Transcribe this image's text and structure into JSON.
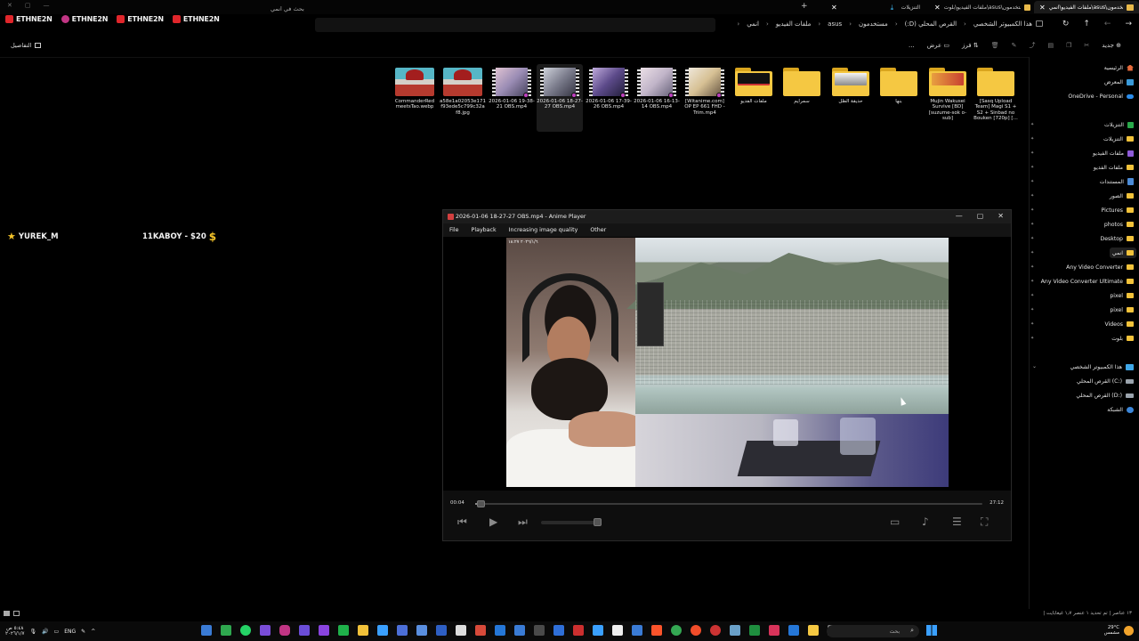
{
  "tabs": [
    {
      "label": "التنزيلات",
      "icon": "download-icon"
    },
    {
      "label": "ملفات الفيديو\\بلوت\\asus\\مستخدمون",
      "icon": "folder-icon"
    },
    {
      "label": "ملفات الفيديو\\انمي\\asus\\مستخدمون",
      "icon": "folder-icon",
      "active": true
    }
  ],
  "brands": [
    "ETHNE2N",
    "ETHNE2N",
    "ETHNE2N",
    "ETHNE2N"
  ],
  "search": {
    "placeholder": "بحث في انمي"
  },
  "breadcrumb": [
    "هذا الكمبيوتر الشخصي",
    "القرص المحلي (D:)",
    "مستخدمون",
    "asus",
    "ملفات الفيديو",
    "انمي"
  ],
  "toolbar": {
    "details": "التفاصيل",
    "new": "جديد",
    "sort": "فرز",
    "view": "عرض",
    "more": "..."
  },
  "files": [
    {
      "name": "CommanderRed meetsTao.webp",
      "kind": "image"
    },
    {
      "name": "a58e1a02053e171 f93ede5c799c32a f8.jpg",
      "kind": "image"
    },
    {
      "name": "2026-01-06 19-38-21 OBS.mp4",
      "kind": "video"
    },
    {
      "name": "2026-01-06 18-27-27 OBS.mp4",
      "kind": "video",
      "selected": true
    },
    {
      "name": "2026-01-06 17-39-26 OBS.mp4",
      "kind": "video"
    },
    {
      "name": "2026-01-06 16-13-14 OBS.mp4",
      "kind": "video"
    },
    {
      "name": "[Witanime.com] OP EP 661 FHD - Trim.mp4",
      "kind": "video"
    },
    {
      "name": "ملفات الفديو",
      "kind": "folder"
    },
    {
      "name": "سمرايم",
      "kind": "folder"
    },
    {
      "name": "حديقة الظل",
      "kind": "folder"
    },
    {
      "name": "بنها",
      "kind": "folder"
    },
    {
      "name": "Mujin Wakusei Survive [BD][suzume-sok o-sub]",
      "kind": "folder"
    },
    {
      "name": "[Sasq Upload Team] Magi S1 + S2 + Sinbad no Bouken [720p] [...",
      "kind": "folder"
    }
  ],
  "sidebar": {
    "items": [
      {
        "label": "الرئيسية",
        "icon": "home-icon"
      },
      {
        "label": "المعرض",
        "icon": "gallery-icon"
      },
      {
        "label": "OneDrive - Personal",
        "icon": "onedrive-icon"
      },
      {
        "label": "التنزيلات",
        "icon": "download-icon"
      },
      {
        "label": "التنزيلات",
        "icon": "folder-icon"
      },
      {
        "label": "ملفات الفيديو",
        "icon": "video-icon"
      },
      {
        "label": "ملفات الفديو",
        "icon": "folder-icon"
      },
      {
        "label": "المستندات",
        "icon": "documents-icon"
      },
      {
        "label": "الصور",
        "icon": "folder-icon"
      },
      {
        "label": "Pictures",
        "icon": "folder-icon"
      },
      {
        "label": "photos",
        "icon": "folder-icon"
      },
      {
        "label": "Desktop",
        "icon": "folder-icon"
      },
      {
        "label": "انمي",
        "icon": "folder-icon",
        "selected": true
      },
      {
        "label": "Any Video Converter",
        "icon": "folder-icon"
      },
      {
        "label": "Any Video Converter Ultimate",
        "icon": "folder-icon"
      },
      {
        "label": "pixel",
        "icon": "folder-icon"
      },
      {
        "label": "pixel",
        "icon": "folder-icon"
      },
      {
        "label": "Videos",
        "icon": "folder-icon"
      },
      {
        "label": "بلوت",
        "icon": "folder-icon"
      },
      {
        "label": "هذا الكمبيوتر الشخصي",
        "icon": "pc-icon"
      },
      {
        "label": "القرص المحلي (C:)",
        "icon": "drive-icon"
      },
      {
        "label": "القرص المحلي (D:)",
        "icon": "drive-icon"
      },
      {
        "label": "الشبكة",
        "icon": "network-icon"
      }
    ]
  },
  "overlay": {
    "member": "YUREK_M",
    "donation": "11KABOY - $20",
    "dollar": "$"
  },
  "player": {
    "title": "2026-01-06 18-27-27 OBS.mp4 - Anime Player",
    "menu": [
      "File",
      "Playback",
      "Increasing image quality",
      "Other"
    ],
    "time_current": "00:04",
    "time_total": "27:12",
    "progress": 0.004,
    "volume": 0.95,
    "cam_caption": "٢٠٢٦/١/٦ ١٨:٢٧"
  },
  "status": {
    "text": "١٣ عناصر | تم تحديد ١ عنصر ١٫٧ غيغابايت |"
  },
  "taskbar": {
    "time": "٥:٤٨ ص",
    "date": "٢٠٢٦/١/٧",
    "lang": "ENG",
    "search": "بحث",
    "weather_temp": "29°C",
    "weather_text": "مشمس"
  },
  "colors": {
    "accent": "#41c2ff",
    "folder": "#f5c842",
    "gold": "#f3c329"
  }
}
